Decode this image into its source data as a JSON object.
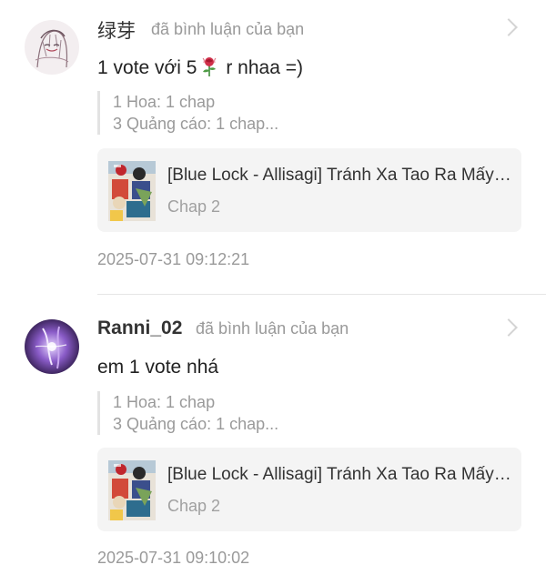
{
  "comments": [
    {
      "username": "绿芽",
      "action": "đã bình luận của bạn",
      "text_before": "1 vote với 5",
      "emoji": "rose-icon",
      "text_after": " r nhaa  =)",
      "quote_lines": [
        "1 Hoa: 1 chap",
        "3 Quảng cáo: 1 chap..."
      ],
      "card_title": "[Blue Lock - Allisagi] Tránh Xa Tao Ra Mấy Thằng Biến Thái",
      "card_chap": "Chap 2",
      "timestamp": "2025-07-31 09:12:21"
    },
    {
      "username": "Ranni_02",
      "action": "đã bình luận của bạn",
      "text": "em 1 vote nhá",
      "quote_lines": [
        "1 Hoa: 1 chap",
        "3 Quảng cáo: 1 chap..."
      ],
      "card_title": "[Blue Lock - Allisagi] Tránh Xa Tao Ra Mấy Thằng Biến Thái",
      "card_chap": "Chap 2",
      "timestamp": "2025-07-31 09:10:02"
    }
  ],
  "colors": {
    "divider": "#e6e6e6",
    "card_bg": "#f4f4f4",
    "muted_text": "#9a9a9a"
  }
}
